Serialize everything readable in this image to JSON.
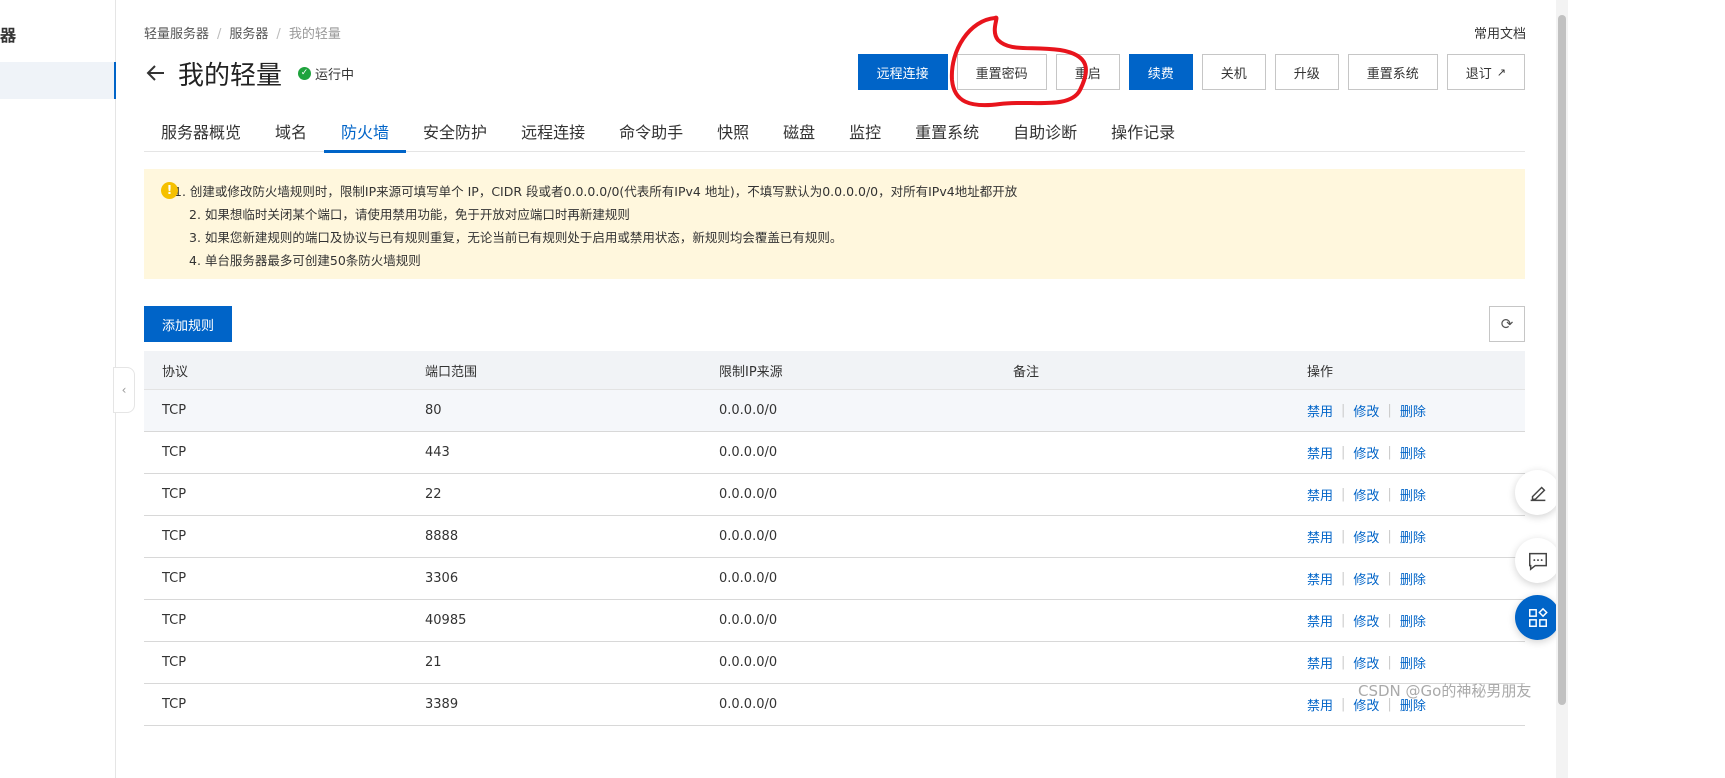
{
  "sidebar": {
    "title": "器"
  },
  "breadcrumb": {
    "item1": "轻量服务器",
    "item2": "服务器",
    "current": "我的轻量"
  },
  "header": {
    "docs": "常用文档",
    "title": "我的轻量",
    "status": "运行中"
  },
  "actions": {
    "remote": "远程连接",
    "reset_password": "重置密码",
    "restart": "重启",
    "renew": "续费",
    "shutdown": "关机",
    "upgrade": "升级",
    "reset_system": "重置系统",
    "refund": "退订"
  },
  "tabs": [
    "服务器概览",
    "域名",
    "防火墙",
    "安全防护",
    "远程连接",
    "命令助手",
    "快照",
    "磁盘",
    "监控",
    "重置系统",
    "自助诊断",
    "操作记录"
  ],
  "active_tab": "防火墙",
  "notice": {
    "lines": [
      "1. 创建或修改防火墙规则时，限制IP来源可填写单个 IP，CIDR 段或者0.0.0.0/0(代表所有IPv4 地址)，不填写默认为0.0.0.0/0，对所有IPv4地址都开放",
      "2. 如果想临时关闭某个端口，请使用禁用功能，免于开放对应端口时再新建规则",
      "3. 如果您新建规则的端口及协议与已有规则重复，无论当前已有规则处于启用或禁用状态，新规则均会覆盖已有规则。",
      "4. 单台服务器最多可创建50条防火墙规则"
    ]
  },
  "toolbar": {
    "add_rule": "添加规则"
  },
  "table": {
    "headers": {
      "protocol": "协议",
      "port": "端口范围",
      "ip": "限制IP来源",
      "remark": "备注",
      "ops": "操作"
    },
    "ops": {
      "disable": "禁用",
      "edit": "修改",
      "delete": "删除"
    },
    "rows": [
      {
        "protocol": "TCP",
        "port": "80",
        "ip": "0.0.0.0/0",
        "remark": ""
      },
      {
        "protocol": "TCP",
        "port": "443",
        "ip": "0.0.0.0/0",
        "remark": ""
      },
      {
        "protocol": "TCP",
        "port": "22",
        "ip": "0.0.0.0/0",
        "remark": ""
      },
      {
        "protocol": "TCP",
        "port": "8888",
        "ip": "0.0.0.0/0",
        "remark": ""
      },
      {
        "protocol": "TCP",
        "port": "3306",
        "ip": "0.0.0.0/0",
        "remark": ""
      },
      {
        "protocol": "TCP",
        "port": "40985",
        "ip": "0.0.0.0/0",
        "remark": ""
      },
      {
        "protocol": "TCP",
        "port": "21",
        "ip": "0.0.0.0/0",
        "remark": ""
      },
      {
        "protocol": "TCP",
        "port": "3389",
        "ip": "0.0.0.0/0",
        "remark": ""
      }
    ]
  },
  "watermark": "CSDN @Go的神秘男朋友",
  "colors": {
    "primary": "#0064c8",
    "notice_bg": "#fff7dd",
    "status_green": "#1fa33d",
    "annotation_red": "#e8141c"
  },
  "icons": {
    "back": "arrow-left-icon",
    "status": "check-circle-icon",
    "refresh": "refresh-icon",
    "external": "external-link-icon",
    "edit": "pencil-icon",
    "chat": "chat-icon",
    "apps": "grid-icon",
    "warning": "warning-icon"
  }
}
